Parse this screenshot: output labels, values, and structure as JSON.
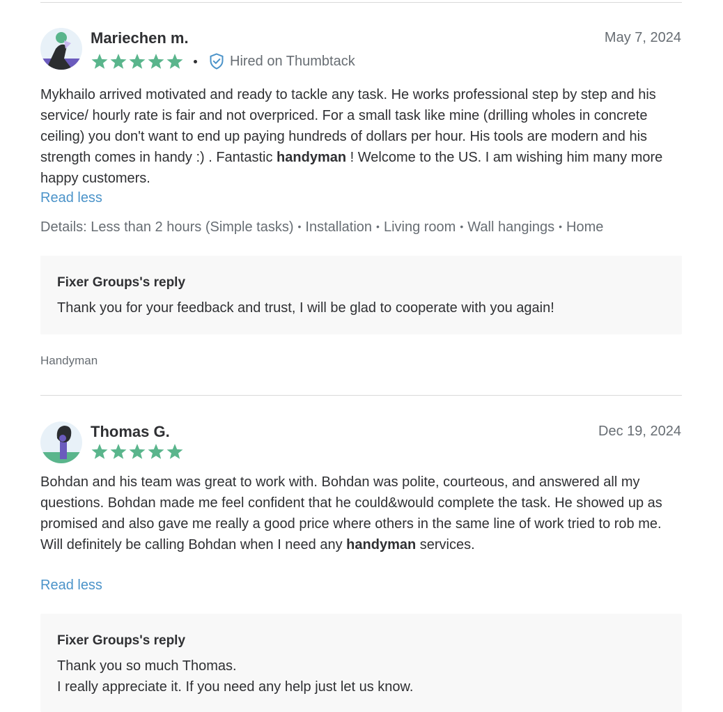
{
  "colors": {
    "star": "#5ab58c",
    "link": "#4b93c9",
    "muted": "#676d73",
    "reply_bg": "#f8f8f8"
  },
  "reviews": [
    {
      "name": "Mariechen m.",
      "date": "May 7, 2024",
      "rating": 5,
      "hired_label": "Hired on Thumbtack",
      "text_before": "Mykhailo arrived motivated and ready to tackle any task. He works professional step by step and his service/ hourly rate is fair and not overpriced. For a small task like mine (drilling wholes in concrete ceiling) you don't want to end up paying hundreds of dollars per hour. His tools are modern and his strength comes in handy :) . Fantastic ",
      "text_bold": "handyman",
      "text_after": " ! Welcome to the US. I am wishing him many more happy customers.",
      "read_less": "Read less",
      "details_label": "Details:",
      "details": [
        "Less than 2 hours (Simple tasks)",
        "Installation",
        "Living room",
        "Wall hangings",
        "Home"
      ],
      "reply_title": "Fixer Groups's reply",
      "reply_lines": [
        "Thank you for your feedback and trust, I will be glad to cooperate with you again!"
      ],
      "category": "Handyman"
    },
    {
      "name": "Thomas G.",
      "date": "Dec 19, 2024",
      "rating": 5,
      "text_before": "Bohdan and his team was great to work with. Bohdan was polite, courteous, and answered all my questions. Bohdan made me feel confident that he could&would complete the task. He showed up as promised and also gave me really a good price where others in the same line of work tried to rob me. Will definitely be calling Bohdan when I need any ",
      "text_bold": "handyman",
      "text_after": " services.",
      "read_less": "Read less",
      "reply_title": "Fixer Groups's reply",
      "reply_lines": [
        "Thank you so much Thomas.",
        "I really appreciate it. If you need any help just let us know."
      ]
    }
  ]
}
